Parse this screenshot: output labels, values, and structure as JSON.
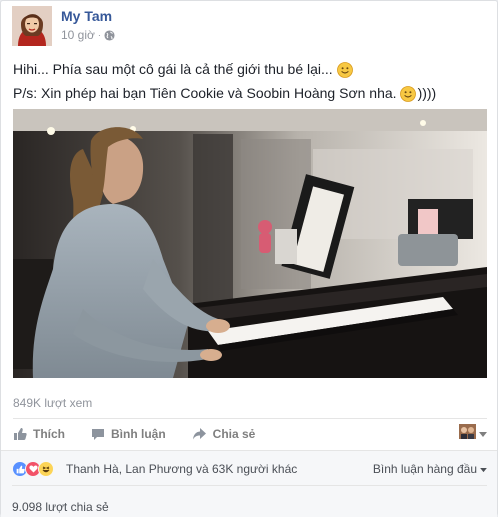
{
  "post": {
    "author": "My Tam",
    "timestamp": "10 giờ",
    "separator": "·",
    "privacy_icon": "globe-icon",
    "line1": "Hihi... Phía sau một cô gái là cả thế giới thu bé lại...",
    "line2": "P/s: Xin phép hai bạn Tiên Cookie và Soobin Hoàng Sơn nha.",
    "line2_suffix": "))))",
    "emoji": "smiley-emoji"
  },
  "video": {
    "subject": "woman-playing-piano"
  },
  "views": "849K lượt xem",
  "actions": {
    "like": "Thích",
    "comment": "Bình luận",
    "share": "Chia sẻ"
  },
  "reactions": {
    "icons": [
      "like-reaction-icon",
      "love-reaction-icon",
      "haha-reaction-icon"
    ],
    "summary": "Thanh Hà, Lan Phương và 63K người khác",
    "sort_label": "Bình luận hàng đầu"
  },
  "shares": "9.098 lượt chia sẻ",
  "colors": {
    "link": "#365899",
    "like_blue": "#5890ff",
    "love_red": "#f25268",
    "haha_yellow": "#fcd457",
    "muted": "#90949c"
  }
}
